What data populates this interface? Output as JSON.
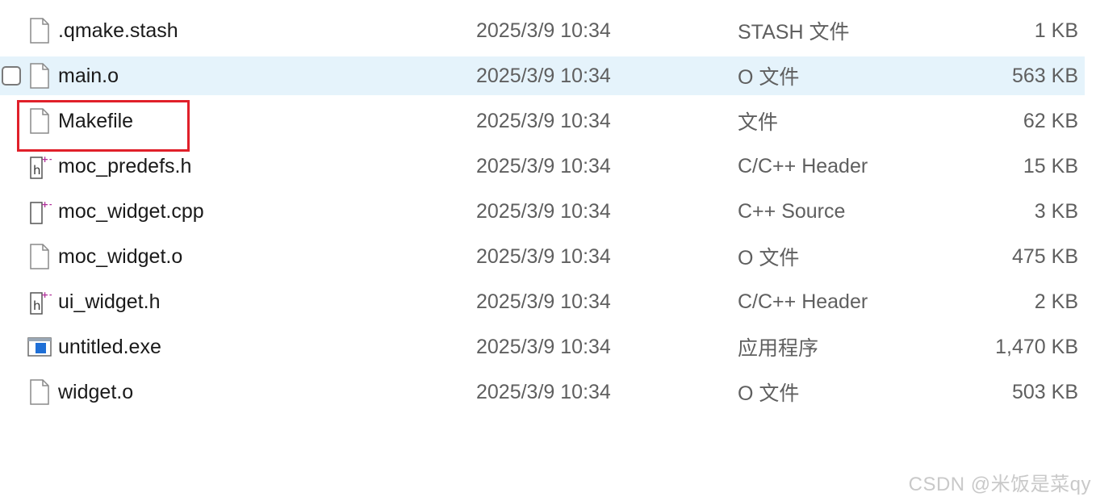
{
  "files": [
    {
      "name": ".qmake.stash",
      "date": "2025/3/9 10:34",
      "type": "STASH 文件",
      "size": "1 KB",
      "icon": "blank-file-icon"
    },
    {
      "name": "main.o",
      "date": "2025/3/9 10:34",
      "type": "O 文件",
      "size": "563 KB",
      "icon": "blank-file-icon",
      "hovered": true
    },
    {
      "name": "Makefile",
      "date": "2025/3/9 10:34",
      "type": "文件",
      "size": "62 KB",
      "icon": "blank-file-icon",
      "highlighted": true
    },
    {
      "name": "moc_predefs.h",
      "date": "2025/3/9 10:34",
      "type": "C/C++ Header",
      "size": "15 KB",
      "icon": "header-file-icon"
    },
    {
      "name": "moc_widget.cpp",
      "date": "2025/3/9 10:34",
      "type": "C++ Source",
      "size": "3 KB",
      "icon": "cpp-source-file-icon"
    },
    {
      "name": "moc_widget.o",
      "date": "2025/3/9 10:34",
      "type": "O 文件",
      "size": "475 KB",
      "icon": "blank-file-icon"
    },
    {
      "name": "ui_widget.h",
      "date": "2025/3/9 10:34",
      "type": "C/C++ Header",
      "size": "2 KB",
      "icon": "header-file-icon"
    },
    {
      "name": "untitled.exe",
      "date": "2025/3/9 10:34",
      "type": "应用程序",
      "size": "1,470 KB",
      "icon": "exe-app-icon"
    },
    {
      "name": "widget.o",
      "date": "2025/3/9 10:34",
      "type": "O 文件",
      "size": "503 KB",
      "icon": "blank-file-icon"
    }
  ],
  "watermark": "CSDN @米饭是菜qy",
  "colors": {
    "hover_bg": "#e5f3fb",
    "highlight_border": "#e0202a",
    "accent_plus": "#b0309a"
  }
}
